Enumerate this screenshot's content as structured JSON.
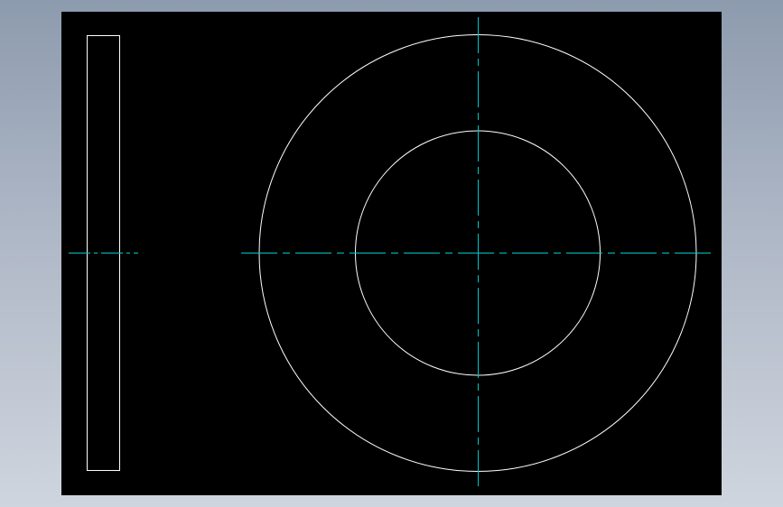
{
  "colors": {
    "background_top": "#8d9bae",
    "background_bottom": "#cfd5de",
    "canvas": "#000000",
    "geometry_line": "#ffffff",
    "centerline": "#00c8c8"
  },
  "views": [
    {
      "view": "side-view",
      "shape": "rectangle",
      "has_centerline": true
    },
    {
      "view": "front-view",
      "shape": "concentric-circles",
      "circle_count": 2,
      "has_centerlines": true
    }
  ],
  "annotations": []
}
